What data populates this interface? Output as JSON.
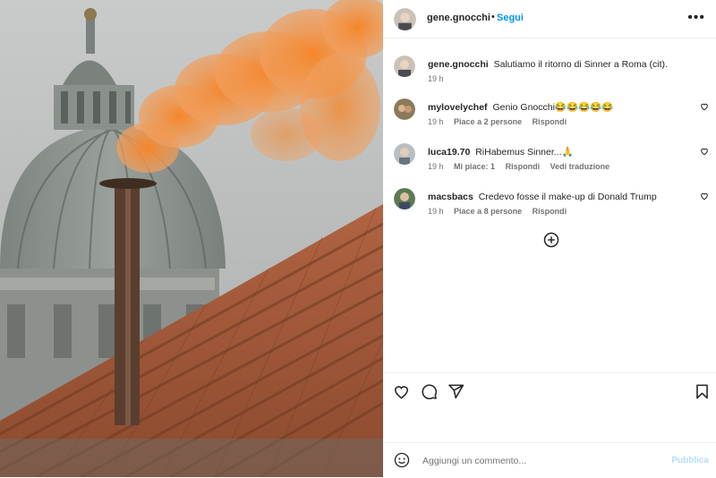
{
  "post": {
    "author": "gene.gnocchi",
    "dot": "•",
    "follow_label": "Segui",
    "more_label": "•••"
  },
  "caption": {
    "username": "gene.gnocchi",
    "text": "Salutiamo il ritorno di Sinner a Roma (cit).",
    "time": "19 h"
  },
  "comments": [
    {
      "username": "mylovelychef",
      "text": "Genio Gnocchi😂😂😂😂😂",
      "time": "19 h",
      "likes": "Piace a 2 persone",
      "reply": "Rispondi",
      "translate": ""
    },
    {
      "username": "luca19.70",
      "text": "RiHabemus Sinner...🙏",
      "time": "19 h",
      "likes": "Mi piace: 1",
      "reply": "Rispondi",
      "translate": "Vedi traduzione"
    },
    {
      "username": "macsbacs",
      "text": "Credevo fosse il make-up di Donald Trump",
      "time": "19 h",
      "likes": "Piace a 8 persone",
      "reply": "Rispondi",
      "translate": ""
    }
  ],
  "icons": {
    "like": "heart-icon",
    "comment": "comment-icon",
    "share": "share-icon",
    "save": "bookmark-icon",
    "emoji": "emoji-icon",
    "load_more": "plus-circle-icon"
  },
  "composer": {
    "placeholder": "Aggiungi un commento...",
    "publish_label": "Pubblica"
  },
  "colors": {
    "accent": "#0095f6",
    "publish_disabled": "#b2dffc",
    "smoke": "#f07a1e"
  }
}
